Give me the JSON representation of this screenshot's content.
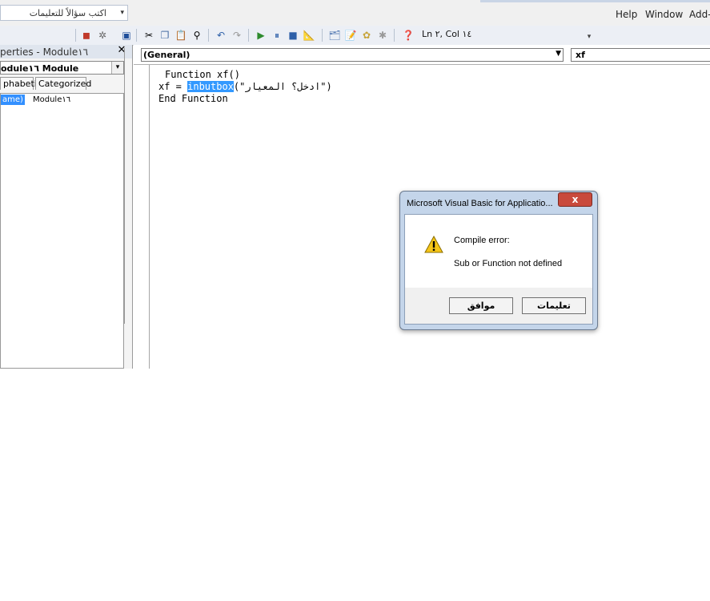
{
  "help_box": {
    "placeholder_text": "اكتب سؤالاً للتعليمات"
  },
  "menu": {
    "help": "Help",
    "window": "Window",
    "addins": "Add-"
  },
  "toolbar": {
    "position_readout": "Ln ٢, Col ١٤"
  },
  "properties": {
    "title": "perties - Module١٦",
    "object_combo": "odule١٦ Module",
    "tab_alphabetic": "phabetic",
    "tab_categorized": "Categorized",
    "row_key": "ame)",
    "row_value": "Module١٦"
  },
  "code_window": {
    "object_combo": "(General)",
    "procedure_combo": "xf",
    "lines": {
      "line1": "Function xf()",
      "line2_prefix": "xf = ",
      "line2_highlight": "inbutbox",
      "line2_suffix": "(\"ادخل؟ المعيار\")",
      "line3": "End Function"
    }
  },
  "dialog": {
    "title": "Microsoft Visual Basic for Applicatio...",
    "close_symbol": "x",
    "message_heading": "Compile error:",
    "message_detail": "Sub or Function not defined",
    "ok_button": "موافق",
    "help_button": "تعليمات"
  },
  "icons": {
    "warning": "warning-icon",
    "close": "close-icon"
  },
  "colors": {
    "selection": "#3399ff",
    "dialog_close": "#c94a3c",
    "run": "#2e8b2e"
  }
}
